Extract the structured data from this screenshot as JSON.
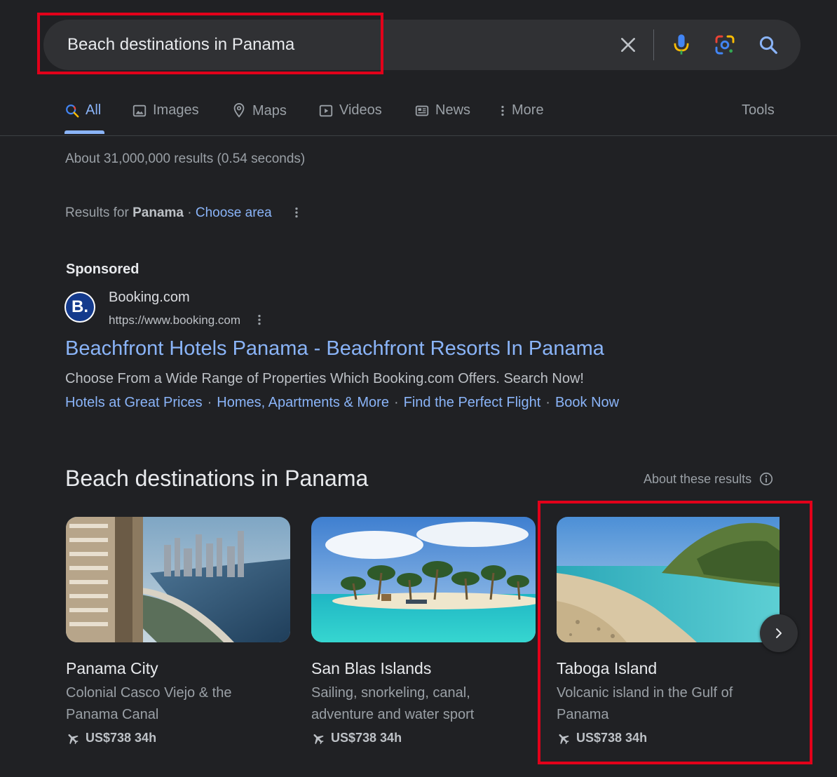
{
  "search": {
    "query": "Beach destinations in Panama"
  },
  "tabs": [
    {
      "label": "All",
      "icon": "search-icon",
      "active": true
    },
    {
      "label": "Images",
      "icon": "image-icon"
    },
    {
      "label": "Maps",
      "icon": "map-pin-icon"
    },
    {
      "label": "Videos",
      "icon": "play-icon"
    },
    {
      "label": "News",
      "icon": "newspaper-icon"
    },
    {
      "label": "More",
      "icon": "more-vertical-icon"
    }
  ],
  "tools_label": "Tools",
  "stats": "About 31,000,000 results (0.54 seconds)",
  "results_for": {
    "prefix": "Results for",
    "location": "Panama",
    "sep": "·",
    "choose": "Choose area"
  },
  "ad": {
    "sponsored": "Sponsored",
    "logo_letter": "B.",
    "site": "Booking.com",
    "url": "https://www.booking.com",
    "title": "Beachfront Hotels Panama - Beachfront Resorts In Panama",
    "description": "Choose From a Wide Range of Properties Which Booking.com Offers. Search Now!",
    "sep": "·",
    "links": [
      "Hotels at Great Prices",
      "Homes, Apartments & More",
      "Find the Perfect Flight",
      "Book Now"
    ]
  },
  "destinations": {
    "heading": "Beach destinations in Panama",
    "about": "About these results",
    "cards": [
      {
        "title": "Panama City",
        "description": "Colonial Casco Viejo & the Panama Canal",
        "price": "US$738 34h"
      },
      {
        "title": "San Blas Islands",
        "description": "Sailing, snorkeling, canal, adventure and water sport",
        "price": "US$738 34h"
      },
      {
        "title": "Taboga Island",
        "description": "Volcanic island in the Gulf of Panama",
        "price": "US$738 34h"
      }
    ]
  },
  "colors": {
    "background": "#202124",
    "link": "#8ab4f8",
    "highlight": "#e2001a"
  }
}
